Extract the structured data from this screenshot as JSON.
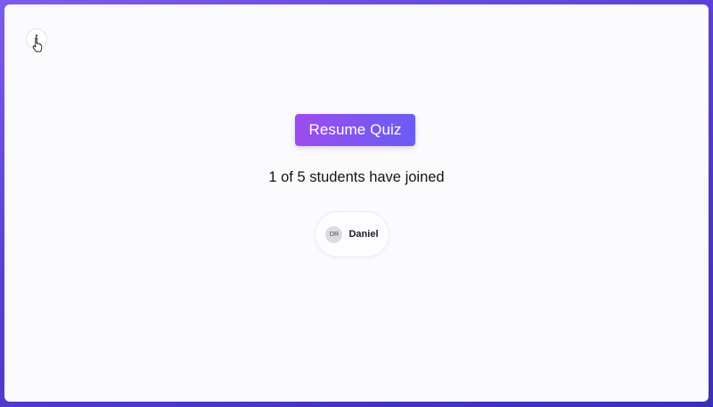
{
  "header": {
    "menu_icon": "more-vertical-icon",
    "cursor_icon": "hand-pointer-icon"
  },
  "quiz": {
    "resume_label": "Resume Quiz",
    "joined_text": "1 of 5 students have joined"
  },
  "students": [
    {
      "initials": "DR",
      "name": "Daniel"
    }
  ],
  "colors": {
    "accent_start": "#9b4cf0",
    "accent_end": "#6a5cf3",
    "frame": "#5b3fd8",
    "panel": "#fbfafd"
  }
}
